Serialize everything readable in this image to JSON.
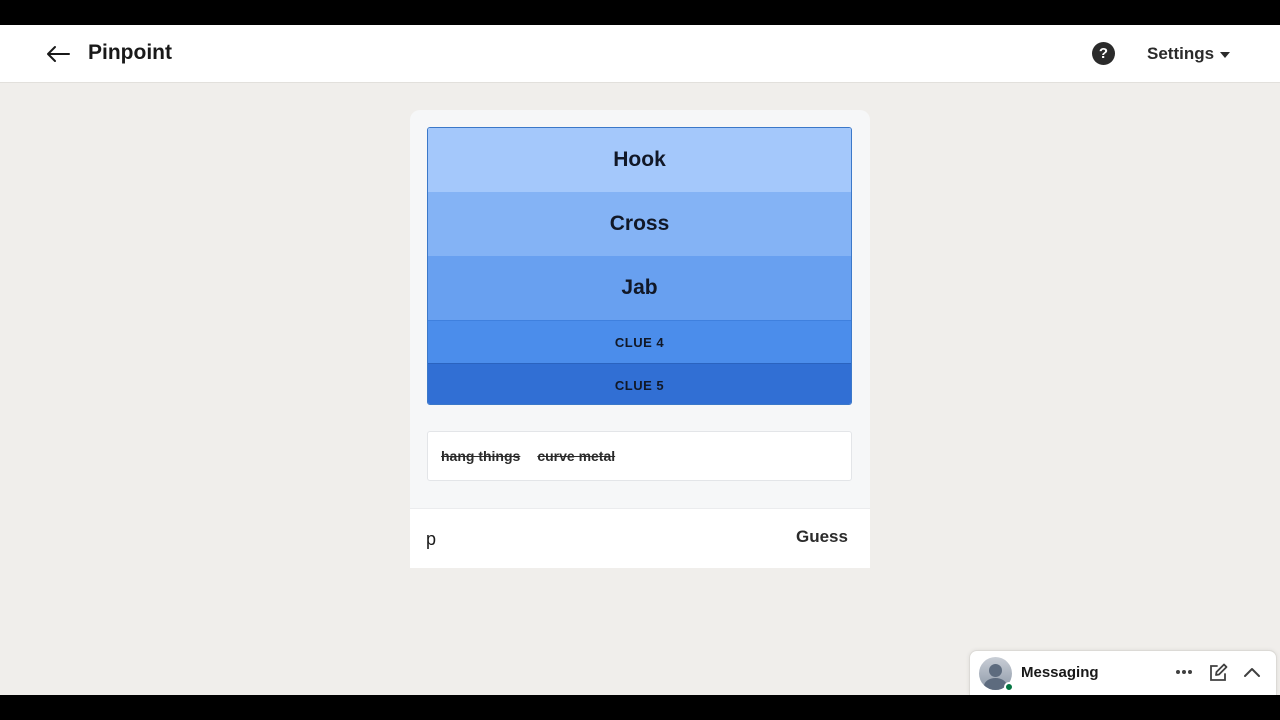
{
  "header": {
    "title": "Pinpoint",
    "help_symbol": "?",
    "settings_label": "Settings",
    "back_icon": "arrow-left-icon",
    "help_icon": "question-circle-icon",
    "settings_icon": "caret-down-icon"
  },
  "game": {
    "clues": [
      {
        "label": "Hook",
        "revealed": true,
        "color": "#a4c8fb"
      },
      {
        "label": "Cross",
        "revealed": true,
        "color": "#84b3f5"
      },
      {
        "label": "Jab",
        "revealed": true,
        "color": "#68a0f0"
      },
      {
        "label": "CLUE 4",
        "revealed": false,
        "color": "#4b8deb"
      },
      {
        "label": "CLUE 5",
        "revealed": false,
        "color": "#316fd4"
      }
    ],
    "previous_guesses": [
      "hang things",
      "curve metal"
    ],
    "input_value": "p",
    "guess_button_label": "Guess"
  },
  "messaging": {
    "label": "Messaging",
    "presence_color": "#057642",
    "more_icon": "ellipsis-icon",
    "compose_icon": "compose-icon",
    "collapse_icon": "chevron-up-icon"
  }
}
